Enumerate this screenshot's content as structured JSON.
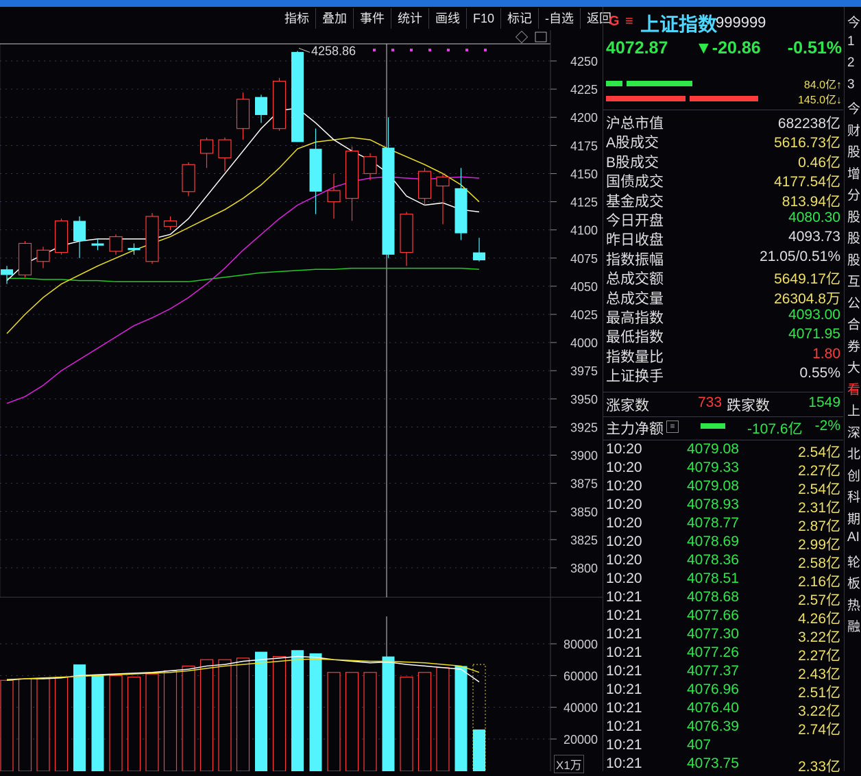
{
  "toolbar": {
    "items": [
      "指标",
      "叠加",
      "事件",
      "统计",
      "画线",
      "F10",
      "标记",
      "-自选",
      "返回"
    ]
  },
  "header": {
    "title": "上证指数",
    "code": "999999",
    "price": "4072.87",
    "change": "▼-20.86",
    "change_pct": "-0.51%"
  },
  "flow": {
    "buy_amount": "84.0亿↑",
    "sell_amount": "145.0亿↓"
  },
  "stats": [
    {
      "k": "沪总市值",
      "v": "682238亿",
      "color": "#e0e0e0"
    },
    {
      "k": "A股成交",
      "v": "5616.73亿",
      "color": "#f0e060"
    },
    {
      "k": "B股成交",
      "v": "0.46亿",
      "color": "#f0e060"
    },
    {
      "k": "国债成交",
      "v": "4177.54亿",
      "color": "#f0e060"
    },
    {
      "k": "基金成交",
      "v": "813.94亿",
      "color": "#f0e060"
    },
    {
      "k": "今日开盘",
      "v": "4080.30",
      "color": "#2ee84a"
    },
    {
      "k": "昨日收盘",
      "v": "4093.73",
      "color": "#e0e0e0"
    },
    {
      "k": "指数振幅",
      "v": "21.05/0.51%",
      "color": "#e0e0e0"
    },
    {
      "k": "总成交额",
      "v": "5649.17亿",
      "color": "#f0e060"
    },
    {
      "k": "总成交量",
      "v": "26304.8万",
      "color": "#f0e060"
    },
    {
      "k": "最高指数",
      "v": "4093.00",
      "color": "#2ee84a"
    },
    {
      "k": "最低指数",
      "v": "4071.95",
      "color": "#2ee84a"
    },
    {
      "k": "指数量比",
      "v": "1.80",
      "color": "#ff3b3b"
    },
    {
      "k": "上证换手",
      "v": "0.55%",
      "color": "#e0e0e0"
    }
  ],
  "breadth": {
    "up_label": "涨家数",
    "up_value": "733",
    "down_label": "跌家数",
    "down_value": "1549"
  },
  "main_flow": {
    "label": "主力净额",
    "value": "-107.6亿",
    "pct": "-2%"
  },
  "ticks": [
    {
      "t": "10:20",
      "p": "4079.08",
      "a": "2.54亿"
    },
    {
      "t": "10:20",
      "p": "4079.33",
      "a": "2.27亿"
    },
    {
      "t": "10:20",
      "p": "4079.08",
      "a": "2.54亿"
    },
    {
      "t": "10:20",
      "p": "4078.93",
      "a": "2.31亿"
    },
    {
      "t": "10:20",
      "p": "4078.77",
      "a": "2.87亿"
    },
    {
      "t": "10:20",
      "p": "4078.69",
      "a": "2.99亿"
    },
    {
      "t": "10:20",
      "p": "4078.36",
      "a": "2.58亿"
    },
    {
      "t": "10:20",
      "p": "4078.51",
      "a": "2.16亿"
    },
    {
      "t": "10:21",
      "p": "4078.68",
      "a": "2.57亿"
    },
    {
      "t": "10:21",
      "p": "4077.66",
      "a": "4.26亿"
    },
    {
      "t": "10:21",
      "p": "4077.30",
      "a": "3.22亿"
    },
    {
      "t": "10:21",
      "p": "4077.26",
      "a": "2.27亿"
    },
    {
      "t": "10:21",
      "p": "4077.37",
      "a": "2.43亿"
    },
    {
      "t": "10:21",
      "p": "4076.96",
      "a": "2.51亿"
    },
    {
      "t": "10:21",
      "p": "4076.40",
      "a": "3.22亿"
    },
    {
      "t": "10:21",
      "p": "4076.39",
      "a": "2.74亿"
    },
    {
      "t": "10:21",
      "p": "407",
      "a": ""
    },
    {
      "t": "10:21",
      "p": "4073.75",
      "a": "2.33亿"
    }
  ],
  "far_right": [
    "今",
    "1",
    "2",
    "3",
    "今",
    "财",
    "股",
    "增",
    "分",
    "股",
    "股",
    "股",
    "互",
    "公",
    "合",
    "券",
    "大",
    "看",
    "上",
    "深",
    "北",
    "创",
    "科",
    "期",
    "AI",
    "轮",
    "板",
    "热",
    "融"
  ],
  "chart_data": {
    "type": "candlestick",
    "price_axis": [
      4250,
      4225,
      4200,
      4175,
      4150,
      4125,
      4100,
      4075,
      4050,
      4025,
      4000,
      3975,
      3950,
      3925,
      3900,
      3875,
      3850,
      3825,
      3800
    ],
    "volume_axis": [
      80000,
      60000,
      40000,
      20000
    ],
    "volume_unit": "X1万",
    "high_marker": "4258.86",
    "candles": [
      {
        "o": 4065,
        "c": 4060,
        "h": 4068,
        "l": 4052
      },
      {
        "o": 4060,
        "c": 4088,
        "h": 4090,
        "l": 4058
      },
      {
        "o": 4072,
        "c": 4082,
        "h": 4085,
        "l": 4066
      },
      {
        "o": 4080,
        "c": 4108,
        "h": 4110,
        "l": 4078
      },
      {
        "o": 4108,
        "c": 4090,
        "h": 4112,
        "l": 4075
      },
      {
        "o": 4088,
        "c": 4086,
        "h": 4092,
        "l": 4082
      },
      {
        "o": 4081,
        "c": 4094,
        "h": 4096,
        "l": 4078
      },
      {
        "o": 4084,
        "c": 4082,
        "h": 4088,
        "l": 4078
      },
      {
        "o": 4072,
        "c": 4112,
        "h": 4115,
        "l": 4070
      },
      {
        "o": 4103,
        "c": 4108,
        "h": 4112,
        "l": 4100
      },
      {
        "o": 4134,
        "c": 4158,
        "h": 4160,
        "l": 4130
      },
      {
        "o": 4168,
        "c": 4180,
        "h": 4182,
        "l": 4155
      },
      {
        "o": 4164,
        "c": 4180,
        "h": 4182,
        "l": 4152
      },
      {
        "o": 4190,
        "c": 4216,
        "h": 4222,
        "l": 4180
      },
      {
        "o": 4218,
        "c": 4202,
        "h": 4220,
        "l": 4195
      },
      {
        "o": 4190,
        "c": 4232,
        "h": 4235,
        "l": 4188
      },
      {
        "o": 4258,
        "c": 4178,
        "h": 4258.86,
        "l": 4178
      },
      {
        "o": 4172,
        "c": 4134,
        "h": 4190,
        "l": 4114
      },
      {
        "o": 4125,
        "c": 4135,
        "h": 4150,
        "l": 4110
      },
      {
        "o": 4128,
        "c": 4170,
        "h": 4174,
        "l": 4108
      },
      {
        "o": 4150,
        "c": 4165,
        "h": 4168,
        "l": 4144
      },
      {
        "o": 4173,
        "c": 4078,
        "h": 4200,
        "l": 4075
      },
      {
        "o": 4080,
        "c": 4114,
        "h": 4116,
        "l": 4068
      },
      {
        "o": 4128,
        "c": 4152,
        "h": 4155,
        "l": 4122
      },
      {
        "o": 4139,
        "c": 4147,
        "h": 4150,
        "l": 4105
      },
      {
        "o": 4137,
        "c": 4097,
        "h": 4155,
        "l": 4091
      },
      {
        "o": 4080,
        "c": 4073,
        "h": 4093,
        "l": 4072
      }
    ],
    "volumes": [
      57000,
      58000,
      58000,
      59000,
      67000,
      60000,
      60000,
      59000,
      61000,
      63000,
      66000,
      70000,
      70000,
      71000,
      75000,
      72000,
      76000,
      74000,
      62000,
      62000,
      62000,
      72000,
      59000,
      62000,
      65000,
      66000,
      26000
    ],
    "vol_bearish": [
      false,
      false,
      false,
      false,
      true,
      true,
      false,
      false,
      false,
      false,
      false,
      false,
      false,
      false,
      true,
      false,
      true,
      true,
      false,
      false,
      false,
      true,
      false,
      false,
      false,
      true,
      true
    ],
    "ma5": [
      4055,
      4070,
      4078,
      4086,
      4090,
      4092,
      4092,
      4092,
      4092,
      4096,
      4110,
      4130,
      4150,
      4170,
      4190,
      4206,
      4208,
      4195,
      4180,
      4170,
      4162,
      4150,
      4130,
      4122,
      4124,
      4118,
      4116
    ],
    "ma10": [
      4008,
      4025,
      4040,
      4052,
      4060,
      4068,
      4075,
      4082,
      4088,
      4094,
      4102,
      4110,
      4118,
      4128,
      4140,
      4155,
      4172,
      4178,
      4180,
      4182,
      4180,
      4172,
      4165,
      4158,
      4150,
      4140,
      4125
    ],
    "ma20": [
      3946,
      3952,
      3962,
      3975,
      3985,
      3995,
      4005,
      4015,
      4022,
      4030,
      4040,
      4052,
      4066,
      4082,
      4096,
      4110,
      4122,
      4130,
      4138,
      4143,
      4146,
      4147,
      4146,
      4145,
      4146,
      4147,
      4146
    ],
    "ma60": [
      4057,
      4057,
      4056,
      4056,
      4055,
      4055,
      4054,
      4054,
      4054,
      4054,
      4054,
      4056,
      4058,
      4060,
      4062,
      4063,
      4064,
      4065,
      4065,
      4066,
      4066,
      4066,
      4066,
      4066,
      4066,
      4066,
      4065
    ],
    "vol_ma5": [
      57000,
      58000,
      58000,
      58500,
      60000,
      60500,
      61000,
      61500,
      62000,
      63000,
      64000,
      66000,
      67000,
      69000,
      70000,
      71000,
      72000,
      71500,
      70000,
      69000,
      68000,
      68500,
      67000,
      66000,
      65000,
      64000,
      56000
    ],
    "vol_ma10": [
      57500,
      58000,
      58500,
      59000,
      59500,
      60000,
      60500,
      61000,
      61500,
      62000,
      63000,
      64500,
      66000,
      67000,
      68000,
      69000,
      70000,
      70500,
      70000,
      69500,
      69000,
      69000,
      68500,
      68000,
      67000,
      66000,
      62000
    ]
  }
}
